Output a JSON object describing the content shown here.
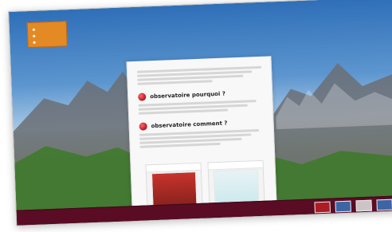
{
  "nav": {
    "items": [
      {
        "label": ""
      },
      {
        "label": ""
      },
      {
        "label": ""
      }
    ]
  },
  "header": {
    "site_title": "",
    "site_subtitle": "",
    "center_lines": [
      "",
      "",
      ""
    ]
  },
  "panel": {
    "section1": {
      "title": "observatoire pourquoi ?"
    },
    "section2": {
      "title": "observatoire comment ?"
    }
  },
  "colors": {
    "accent_orange": "#e48a25",
    "footer": "#5a0c24",
    "section_icon": "#bf1f2b"
  },
  "icons": {
    "section_icon": "red-circle-icon",
    "nav_bullet": "bullet-icon"
  }
}
